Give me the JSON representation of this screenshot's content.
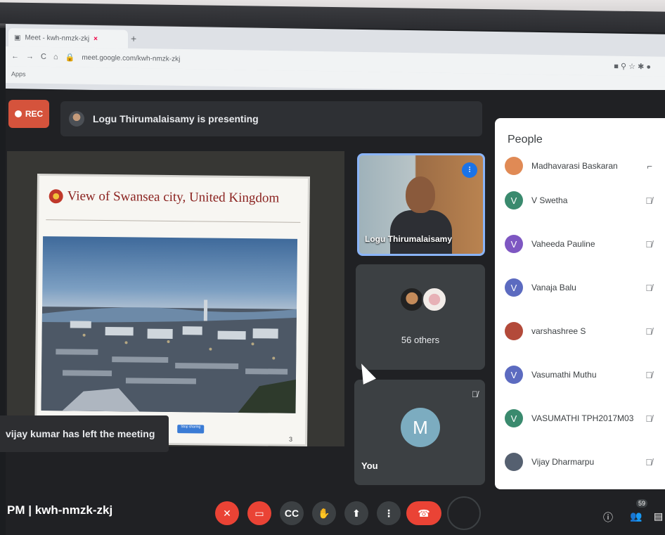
{
  "browser": {
    "tab_title": "Meet - kwh-nmzk-zkj",
    "tab_close": "×",
    "new_tab": "+",
    "url": "meet.google.com/kwh-nmzk-zkj",
    "bookmarks_label": "Apps",
    "nav_back": "←",
    "nav_forward": "→",
    "nav_reload": "C"
  },
  "recording": {
    "label": "REC"
  },
  "presenter_bar": {
    "text": "Logu Thirumalaisamy is presenting"
  },
  "slide": {
    "title": "View of  Swansea city, United Kingdom",
    "page_number": "3",
    "button_label": "Stop sharing"
  },
  "toast": {
    "text": "vijay kumar has left the meeting"
  },
  "tiles": {
    "presenter_name": "Logu Thirumalaisamy",
    "others_label": "56 others",
    "you_label": "You",
    "you_initial": "M"
  },
  "people_panel": {
    "title": "People",
    "partial_name": "Madhavarasi Baskaran",
    "participants": [
      {
        "initial": "V",
        "name": "V Swetha",
        "color": "#3a8a6e"
      },
      {
        "initial": "V",
        "name": "Vaheeda Pauline",
        "color": "#7e57c2"
      },
      {
        "initial": "V",
        "name": "Vanaja Balu",
        "color": "#5c6bc0"
      },
      {
        "initial": "",
        "name": "varshashree S",
        "color": "#b34a3a"
      },
      {
        "initial": "V",
        "name": "Vasumathi Muthu",
        "color": "#5c6bc0"
      },
      {
        "initial": "V",
        "name": "VASUMATHI TPH2017M03",
        "color": "#3a8a6e"
      },
      {
        "initial": "",
        "name": "Vijay Dharmarpu",
        "color": "#556070"
      }
    ]
  },
  "bottom_bar": {
    "meeting_code": "PM  |  kwh-nmzk-zkj",
    "participant_count": "59"
  },
  "colors": {
    "red": "#ea4335",
    "accent": "#8ab4f8",
    "panel": "#ffffff"
  }
}
